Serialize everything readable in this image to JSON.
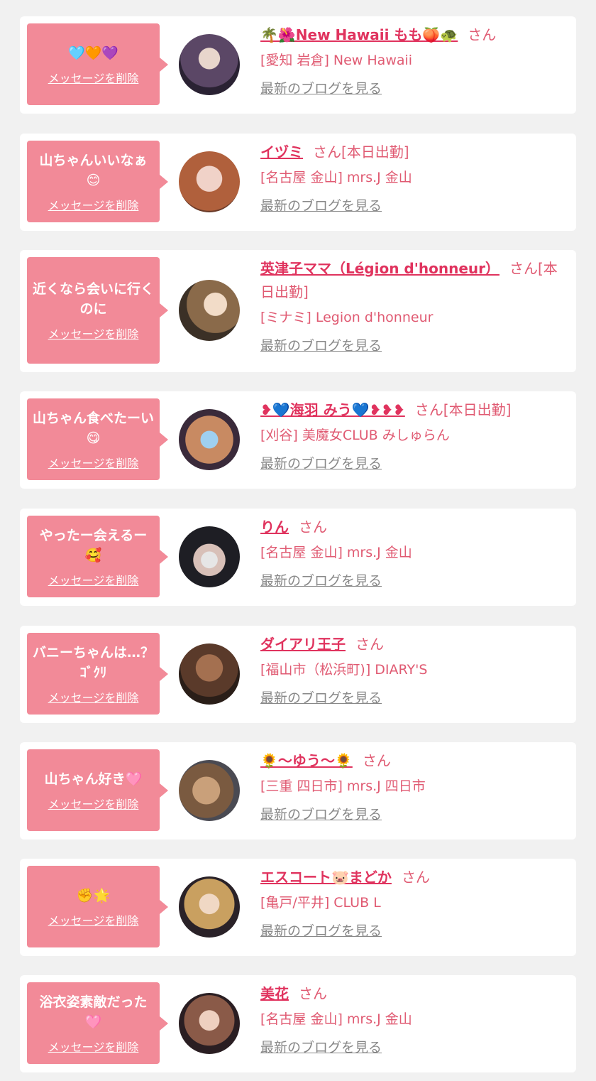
{
  "delete_label": "メッセージを削除",
  "blog_label": "最新のブログを見る",
  "items": [
    {
      "message": "🩵🧡💜",
      "name": "🌴🌺New Hawaii もも🍑🐢",
      "suffix": "さん",
      "shop": "[愛知 岩倉] New Hawaii"
    },
    {
      "message": "山ちゃんいいなぁ😊",
      "name": "イヅミ",
      "suffix": "さん[本日出勤]",
      "shop": "[名古屋 金山] mrs.J 金山"
    },
    {
      "message": "近くなら会いに行くのに",
      "name": "英津子ママ（Légion d'honneur）",
      "suffix": "さん[本日出勤]",
      "shop": "[ミナミ] Legion d'honneur"
    },
    {
      "message": "山ちゃん食べたーい😋",
      "name": "❥💙海羽 みう💙❥❥❥",
      "suffix": "さん[本日出勤]",
      "shop": "[刈谷] 美魔女CLUB みしゅらん"
    },
    {
      "message": "やったー会えるー🥰",
      "name": "りん",
      "suffix": "さん",
      "shop": "[名古屋 金山] mrs.J 金山"
    },
    {
      "message": "バニーちゃんは…？ｺﾞｸﾘ",
      "name": "ダイアリ王子",
      "suffix": "さん",
      "shop": "[福山市（松浜町)] DIARY'S"
    },
    {
      "message": "山ちゃん好き🩷",
      "name": "🌻～ゆう～🌻",
      "suffix": "さん",
      "shop": "[三重 四日市] mrs.J 四日市"
    },
    {
      "message": "✊🌟",
      "name": "エスコート🐷まどか",
      "suffix": "さん",
      "shop": "[亀戸/平井] CLUB L"
    },
    {
      "message": "浴衣姿素敵だった🩷",
      "name": "美花",
      "suffix": "さん",
      "shop": "[名古屋 金山] mrs.J 金山"
    }
  ]
}
